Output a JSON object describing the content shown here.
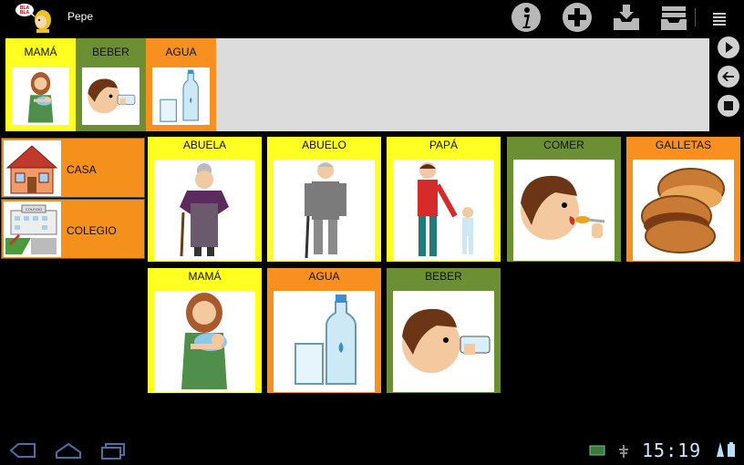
{
  "header": {
    "user_name": "Pepe",
    "logo_text": "BLA BLA"
  },
  "toolbar": [
    "info-icon",
    "add-icon",
    "inbox-icon",
    "archive-icon",
    "menu-icon"
  ],
  "sentence": [
    {
      "label": "MAMÁ",
      "color": "#ffff22",
      "icon": "mother-baby"
    },
    {
      "label": "BEBER",
      "color": "#6b8f32",
      "icon": "drink"
    },
    {
      "label": "AGUA",
      "color": "#f7901e",
      "icon": "water"
    }
  ],
  "sentence_controls": [
    "play-icon",
    "back-icon",
    "stop-icon"
  ],
  "categories": [
    {
      "label": "CASA",
      "icon": "house"
    },
    {
      "label": "COLEGIO",
      "icon": "school",
      "sign": "COLEGIO"
    }
  ],
  "pictograms": {
    "row1": [
      {
        "label": "ABUELA",
        "color": "#ffff22",
        "icon": "grandmother"
      },
      {
        "label": "ABUELO",
        "color": "#ffff22",
        "icon": "grandfather"
      },
      {
        "label": "PAPÁ",
        "color": "#ffff22",
        "icon": "father"
      },
      {
        "label": "COMER",
        "color": "#6b8f32",
        "icon": "eat"
      },
      {
        "label": "GALLETAS",
        "color": "#f7901e",
        "icon": "cookies"
      }
    ],
    "row2": [
      {
        "label": "MAMÁ",
        "color": "#ffff22",
        "icon": "mother-baby"
      },
      {
        "label": "AGUA",
        "color": "#f7901e",
        "icon": "water"
      },
      {
        "label": "BEBER",
        "color": "#6b8f32",
        "icon": "drink"
      }
    ]
  },
  "system": {
    "time": "15:19"
  }
}
